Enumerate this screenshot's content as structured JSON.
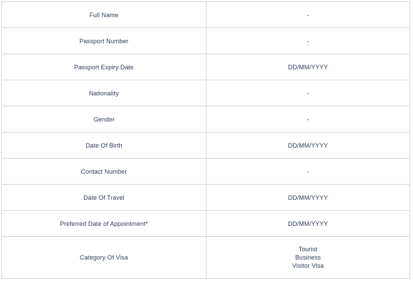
{
  "form": {
    "rows": [
      {
        "label": "Full Name",
        "value": "-"
      },
      {
        "label": "Passport Number",
        "value": "-"
      },
      {
        "label": "Passport Expiry Date",
        "value": "DD/MM/YYYY"
      },
      {
        "label": "Nationality",
        "value": "-"
      },
      {
        "label": "Gender",
        "value": "-"
      },
      {
        "label": "Date Of Birth",
        "value": "DD/MM/YYYY"
      },
      {
        "label": "Contact Number",
        "value": "-"
      },
      {
        "label": "Date Of Travel",
        "value": "DD/MM/YYYY"
      },
      {
        "label": "Preferred Date of Appointment*",
        "value": "DD/MM/YYYY"
      }
    ],
    "visa": {
      "label": "Category Of Visa",
      "options": [
        "Tourist",
        "Business",
        "Visitor Visa"
      ]
    }
  }
}
